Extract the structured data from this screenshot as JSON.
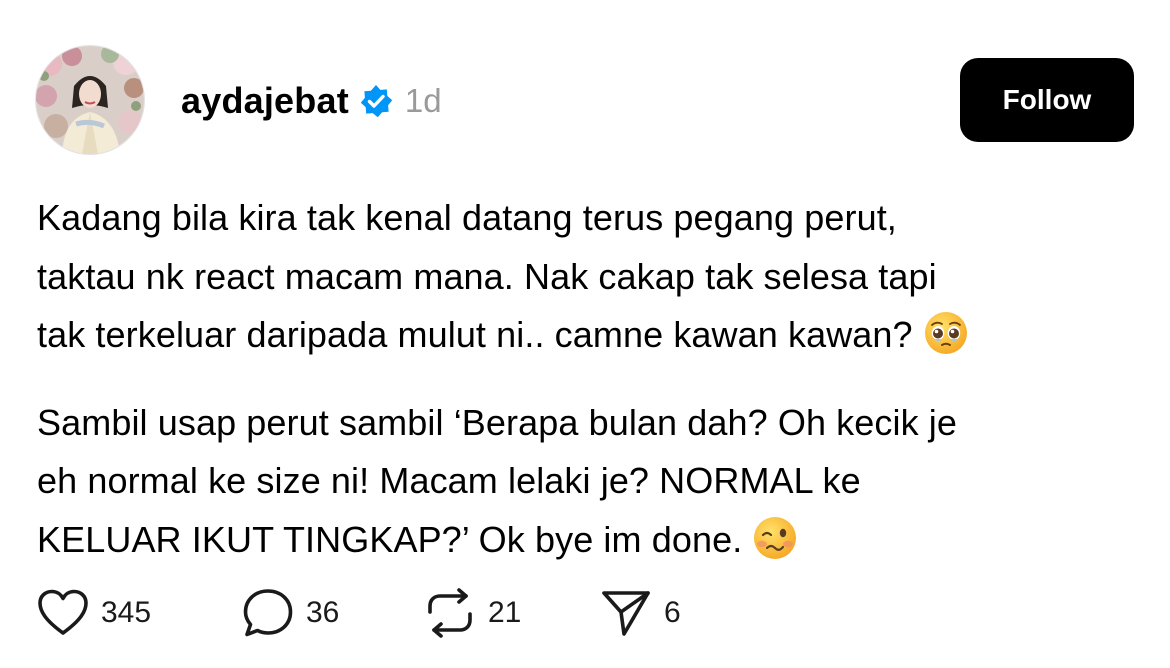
{
  "post": {
    "username": "aydajebat",
    "verified": true,
    "timestamp": "1d",
    "follow_label": "Follow",
    "paragraphs": [
      {
        "lines": [
          "Kadang bila kira tak kenal datang terus pegang perut,",
          "taktau nk react macam mana. Nak cakap tak selesa tapi",
          "tak terkeluar daripada mulut ni.. camne kawan kawan?"
        ],
        "emoji": "pleading-face-emoji"
      },
      {
        "lines": [
          "Sambil usap perut sambil ‘Berapa bulan dah? Oh kecik je",
          "eh normal ke size ni! Macam lelaki je? NORMAL ke",
          "KELUAR IKUT TINGKAP?’ Ok bye im done."
        ],
        "emoji": "woozy-face-emoji"
      }
    ],
    "actions": {
      "likes": "345",
      "replies": "36",
      "reposts": "21",
      "shares": "6"
    }
  },
  "colors": {
    "verified_badge": "#0095f6",
    "timestamp": "#9a9a9a",
    "follow_button_bg": "#000000",
    "follow_button_text": "#ffffff"
  },
  "icons": {
    "like": "heart-icon",
    "reply": "comment-bubble-icon",
    "repost": "repost-icon",
    "share": "send-icon"
  }
}
